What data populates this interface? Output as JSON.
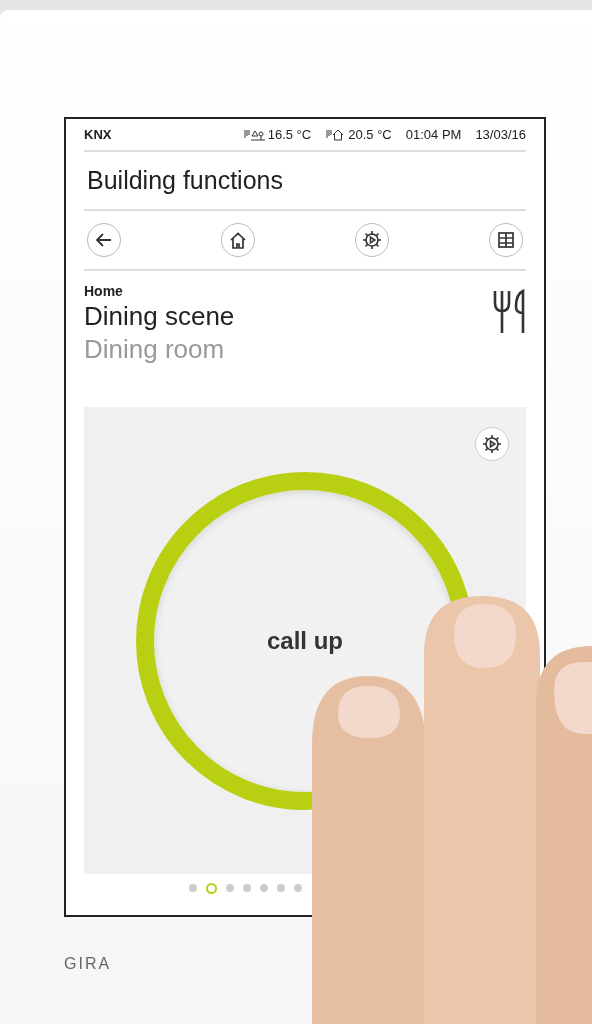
{
  "status_bar": {
    "system": "KNX",
    "outdoor_temperature": "16.5 °C",
    "indoor_temperature": "20.5 °C",
    "time": "01:04 PM",
    "date": "13/03/16"
  },
  "title": "Building functions",
  "nav_buttons": [
    {
      "kind": "back"
    },
    {
      "kind": "home"
    },
    {
      "kind": "scenes"
    },
    {
      "kind": "grid"
    }
  ],
  "function": {
    "location": "Home",
    "name": "Dining scene",
    "room": "Dining room"
  },
  "scene_button": {
    "label": "call up"
  },
  "pages": [
    {
      "selected": false
    },
    {
      "selected": true
    },
    {
      "selected": false
    },
    {
      "selected": false
    },
    {
      "selected": false
    },
    {
      "selected": false
    },
    {
      "selected": false
    }
  ],
  "brand": "GIRA"
}
